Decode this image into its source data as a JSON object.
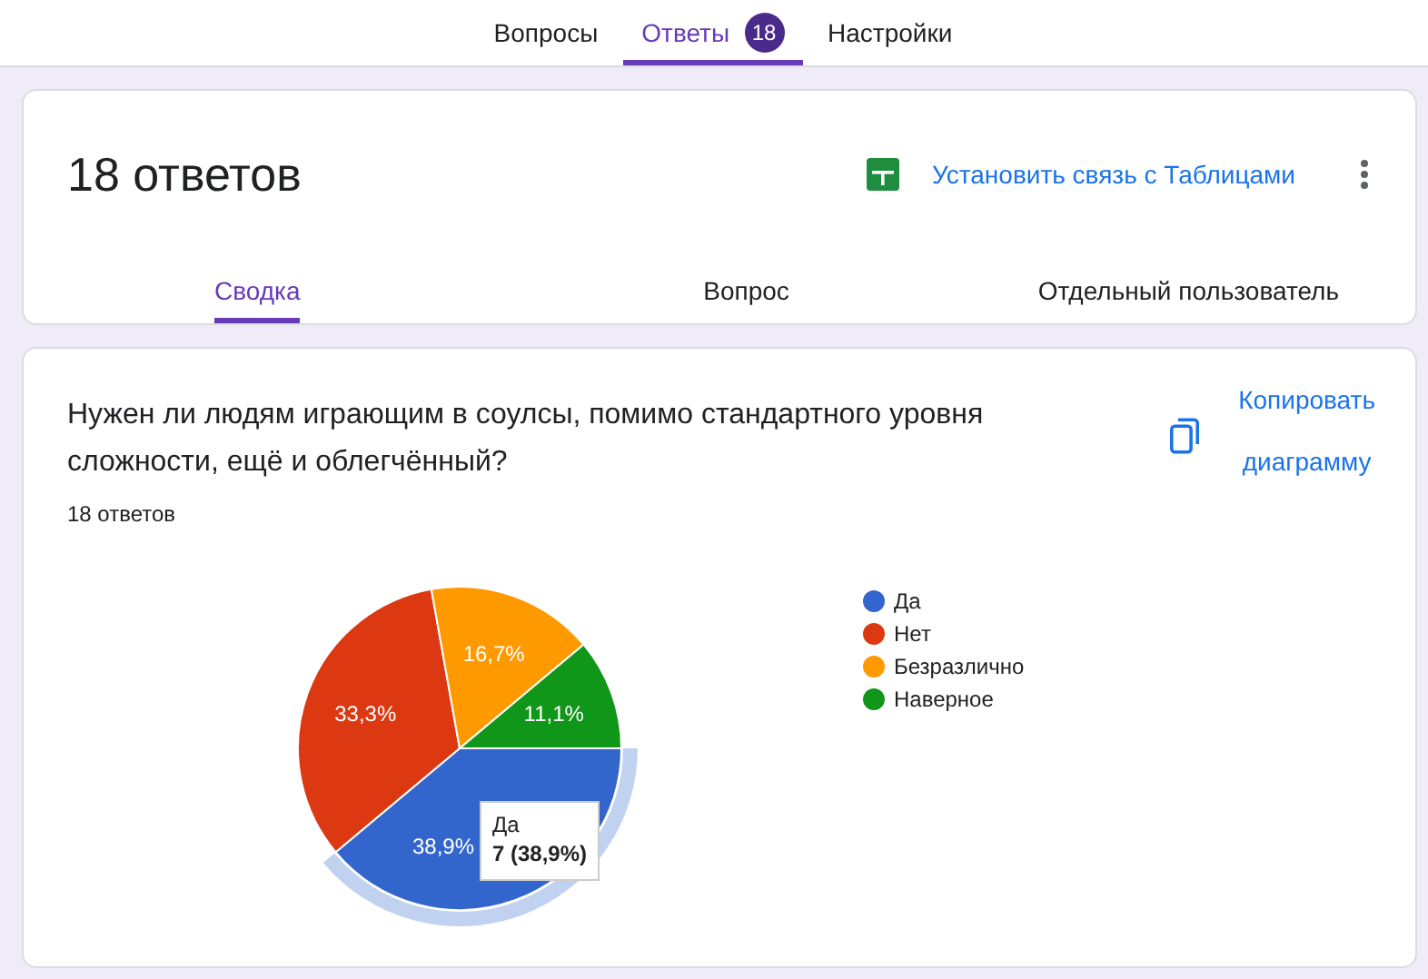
{
  "tabs": [
    {
      "label": "Вопросы",
      "selected": false
    },
    {
      "label": "Ответы",
      "selected": true,
      "badge": "18"
    },
    {
      "label": "Настройки",
      "selected": false
    }
  ],
  "summary": {
    "title": "18 ответов",
    "link_sheets": "Установить связь с Таблицами",
    "subtabs": [
      {
        "label": "Сводка",
        "selected": true
      },
      {
        "label": "Вопрос",
        "selected": false
      },
      {
        "label": "Отдельный пользователь",
        "selected": false
      }
    ]
  },
  "question": {
    "text": "Нужен ли людям играющим в соулсы,  помимо стандартного уровня сложности, ещё и облегчённый?",
    "count": "18 ответов",
    "copy_button": [
      "Копировать",
      "диаграмму"
    ],
    "chart_data": {
      "type": "pie",
      "categories": [
        "Да",
        "Нет",
        "Безразлично",
        "Наверное"
      ],
      "values": [
        38.9,
        33.3,
        16.7,
        11.1
      ],
      "colors": [
        "#3366cc",
        "#dc3912",
        "#ff9900",
        "#109618"
      ],
      "data_labels": true,
      "value_labels": [
        "38,9%",
        "33,3%",
        "16,7%",
        "11,1%"
      ],
      "legend": "right"
    },
    "highlighted": [
      true,
      false,
      false,
      false
    ],
    "tooltip": {
      "label": "Да",
      "value": "7 (38,9%)"
    }
  }
}
